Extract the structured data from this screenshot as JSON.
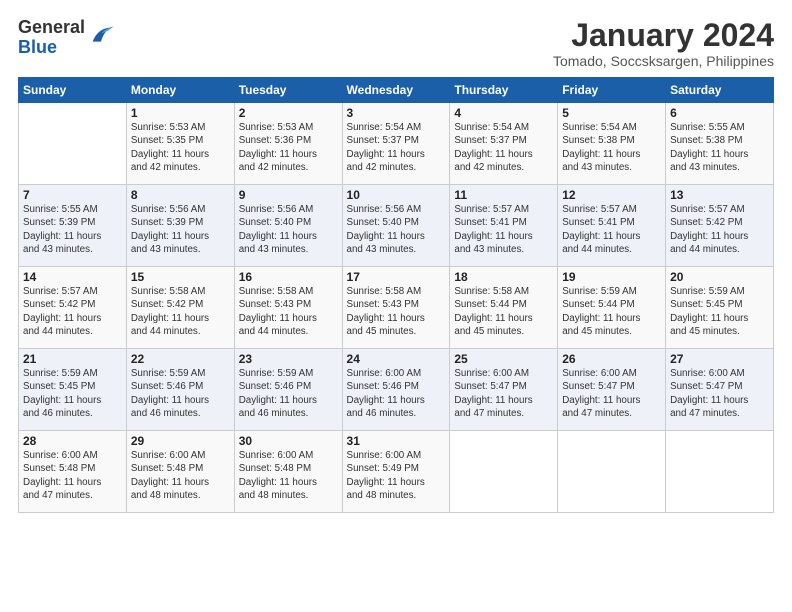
{
  "header": {
    "logo_line1": "General",
    "logo_line2": "Blue",
    "title": "January 2024",
    "subtitle": "Tomado, Soccsksargen, Philippines"
  },
  "weekdays": [
    "Sunday",
    "Monday",
    "Tuesday",
    "Wednesday",
    "Thursday",
    "Friday",
    "Saturday"
  ],
  "weeks": [
    [
      {
        "num": "",
        "info": ""
      },
      {
        "num": "1",
        "info": "Sunrise: 5:53 AM\nSunset: 5:35 PM\nDaylight: 11 hours\nand 42 minutes."
      },
      {
        "num": "2",
        "info": "Sunrise: 5:53 AM\nSunset: 5:36 PM\nDaylight: 11 hours\nand 42 minutes."
      },
      {
        "num": "3",
        "info": "Sunrise: 5:54 AM\nSunset: 5:37 PM\nDaylight: 11 hours\nand 42 minutes."
      },
      {
        "num": "4",
        "info": "Sunrise: 5:54 AM\nSunset: 5:37 PM\nDaylight: 11 hours\nand 42 minutes."
      },
      {
        "num": "5",
        "info": "Sunrise: 5:54 AM\nSunset: 5:38 PM\nDaylight: 11 hours\nand 43 minutes."
      },
      {
        "num": "6",
        "info": "Sunrise: 5:55 AM\nSunset: 5:38 PM\nDaylight: 11 hours\nand 43 minutes."
      }
    ],
    [
      {
        "num": "7",
        "info": "Sunrise: 5:55 AM\nSunset: 5:39 PM\nDaylight: 11 hours\nand 43 minutes."
      },
      {
        "num": "8",
        "info": "Sunrise: 5:56 AM\nSunset: 5:39 PM\nDaylight: 11 hours\nand 43 minutes."
      },
      {
        "num": "9",
        "info": "Sunrise: 5:56 AM\nSunset: 5:40 PM\nDaylight: 11 hours\nand 43 minutes."
      },
      {
        "num": "10",
        "info": "Sunrise: 5:56 AM\nSunset: 5:40 PM\nDaylight: 11 hours\nand 43 minutes."
      },
      {
        "num": "11",
        "info": "Sunrise: 5:57 AM\nSunset: 5:41 PM\nDaylight: 11 hours\nand 43 minutes."
      },
      {
        "num": "12",
        "info": "Sunrise: 5:57 AM\nSunset: 5:41 PM\nDaylight: 11 hours\nand 44 minutes."
      },
      {
        "num": "13",
        "info": "Sunrise: 5:57 AM\nSunset: 5:42 PM\nDaylight: 11 hours\nand 44 minutes."
      }
    ],
    [
      {
        "num": "14",
        "info": "Sunrise: 5:57 AM\nSunset: 5:42 PM\nDaylight: 11 hours\nand 44 minutes."
      },
      {
        "num": "15",
        "info": "Sunrise: 5:58 AM\nSunset: 5:42 PM\nDaylight: 11 hours\nand 44 minutes."
      },
      {
        "num": "16",
        "info": "Sunrise: 5:58 AM\nSunset: 5:43 PM\nDaylight: 11 hours\nand 44 minutes."
      },
      {
        "num": "17",
        "info": "Sunrise: 5:58 AM\nSunset: 5:43 PM\nDaylight: 11 hours\nand 45 minutes."
      },
      {
        "num": "18",
        "info": "Sunrise: 5:58 AM\nSunset: 5:44 PM\nDaylight: 11 hours\nand 45 minutes."
      },
      {
        "num": "19",
        "info": "Sunrise: 5:59 AM\nSunset: 5:44 PM\nDaylight: 11 hours\nand 45 minutes."
      },
      {
        "num": "20",
        "info": "Sunrise: 5:59 AM\nSunset: 5:45 PM\nDaylight: 11 hours\nand 45 minutes."
      }
    ],
    [
      {
        "num": "21",
        "info": "Sunrise: 5:59 AM\nSunset: 5:45 PM\nDaylight: 11 hours\nand 46 minutes."
      },
      {
        "num": "22",
        "info": "Sunrise: 5:59 AM\nSunset: 5:46 PM\nDaylight: 11 hours\nand 46 minutes."
      },
      {
        "num": "23",
        "info": "Sunrise: 5:59 AM\nSunset: 5:46 PM\nDaylight: 11 hours\nand 46 minutes."
      },
      {
        "num": "24",
        "info": "Sunrise: 6:00 AM\nSunset: 5:46 PM\nDaylight: 11 hours\nand 46 minutes."
      },
      {
        "num": "25",
        "info": "Sunrise: 6:00 AM\nSunset: 5:47 PM\nDaylight: 11 hours\nand 47 minutes."
      },
      {
        "num": "26",
        "info": "Sunrise: 6:00 AM\nSunset: 5:47 PM\nDaylight: 11 hours\nand 47 minutes."
      },
      {
        "num": "27",
        "info": "Sunrise: 6:00 AM\nSunset: 5:47 PM\nDaylight: 11 hours\nand 47 minutes."
      }
    ],
    [
      {
        "num": "28",
        "info": "Sunrise: 6:00 AM\nSunset: 5:48 PM\nDaylight: 11 hours\nand 47 minutes."
      },
      {
        "num": "29",
        "info": "Sunrise: 6:00 AM\nSunset: 5:48 PM\nDaylight: 11 hours\nand 48 minutes."
      },
      {
        "num": "30",
        "info": "Sunrise: 6:00 AM\nSunset: 5:48 PM\nDaylight: 11 hours\nand 48 minutes."
      },
      {
        "num": "31",
        "info": "Sunrise: 6:00 AM\nSunset: 5:49 PM\nDaylight: 11 hours\nand 48 minutes."
      },
      {
        "num": "",
        "info": ""
      },
      {
        "num": "",
        "info": ""
      },
      {
        "num": "",
        "info": ""
      }
    ]
  ]
}
